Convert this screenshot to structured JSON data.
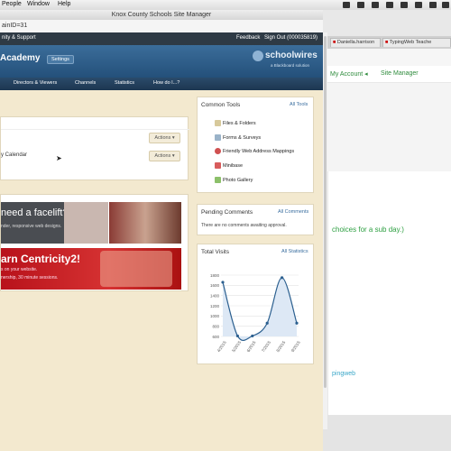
{
  "menubar": {
    "items": [
      "People",
      "Window",
      "Help"
    ]
  },
  "window": {
    "title": "Knox County Schools Site Manager",
    "url_fragment": "ainID=31"
  },
  "top_row": {
    "left_text": "nity & Support",
    "feedback": "Feedback",
    "signout": "Sign Out (000035819)"
  },
  "header": {
    "site_name": "Academy",
    "settings_button": "Settings",
    "brand_name": "schoolwires",
    "brand_sub": "a Blackboard solution"
  },
  "nav": {
    "items": [
      "Directors & Viewers",
      "Channels",
      "Statistics",
      "How do I...?"
    ]
  },
  "content_panel": {
    "row2_label": "y Calendar",
    "actions_label": "Actions ▾"
  },
  "banners": {
    "facelift_title": "need a facelift?",
    "facelift_sub": "nder, responsive web designs.",
    "centricity_title": "arn Centricity2!",
    "centricity_sub1": "s on your website.",
    "centricity_sub2": "nership, 30 minute sessions."
  },
  "common_tools": {
    "title": "Common Tools",
    "link": "All Tools",
    "items": [
      "Files & Folders",
      "Forms & Surveys",
      "Friendly Web Address Mappings",
      "Minibase",
      "Photo Gallery"
    ]
  },
  "pending": {
    "title": "Pending Comments",
    "link": "All Comments",
    "message": "There are no comments awaiting approval."
  },
  "visits": {
    "title": "Total Visits",
    "link": "All Statistics"
  },
  "chart_data": {
    "type": "line",
    "title": "",
    "x": [
      "4/2015",
      "5/2015",
      "6/2015",
      "7/2015",
      "8/2015",
      "9/2015"
    ],
    "values": [
      1660,
      610,
      610,
      860,
      1750,
      860
    ],
    "ylim": [
      600,
      1800
    ],
    "yticks": [
      600,
      800,
      1000,
      1200,
      1400,
      1600,
      1800
    ],
    "grid": true
  },
  "background_window": {
    "tabs": [
      "Daniella.harrison",
      "TypingWeb Teache"
    ],
    "nav_links": [
      "My Account ◂",
      "Site Manager"
    ],
    "note": "choices for a sub day.)",
    "logo_text": "pingweb"
  },
  "colors": {
    "header": "#2f5f8c",
    "accent_link": "#3a6e9f",
    "background_page": "#f3e9cf",
    "bg_green": "#2fa043"
  }
}
